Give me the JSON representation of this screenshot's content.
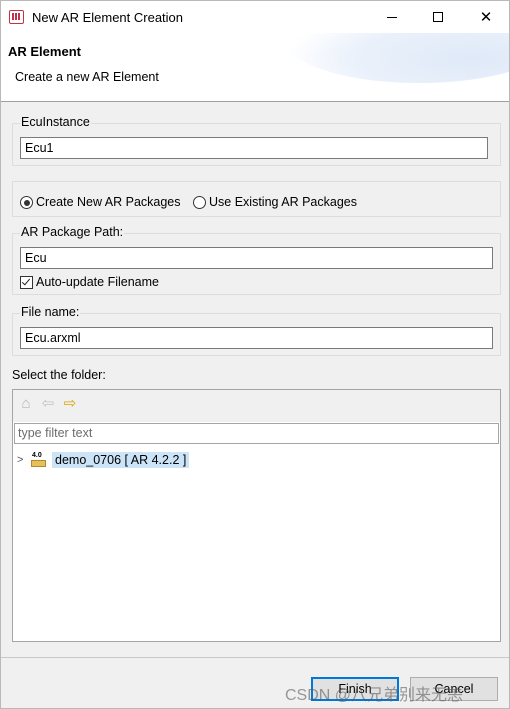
{
  "window": {
    "title": "New AR Element Creation",
    "close_glyph": "✕"
  },
  "header": {
    "title": "AR Element",
    "subtitle": "Create a new AR Element"
  },
  "ecu_instance": {
    "label": "EcuInstance",
    "value": "Ecu1"
  },
  "packages": {
    "create_new_label": "Create New AR Packages",
    "use_existing_label": "Use Existing AR Packages",
    "selected": "create_new"
  },
  "package_path": {
    "label": "AR Package Path:",
    "value": "Ecu",
    "auto_update_label": "Auto-update Filename",
    "auto_update_checked": true
  },
  "file_name": {
    "label": "File name:",
    "value": "Ecu.arxml"
  },
  "folder": {
    "label": "Select the folder:",
    "filter_placeholder": "type filter text",
    "toolbar": {
      "home_icon": "⌂",
      "back_icon": "⇦",
      "forward_icon": "⇨"
    },
    "tree": [
      {
        "label": "demo_0706 [ AR 4.2.2 ]",
        "icon_badge": "4.0"
      }
    ]
  },
  "buttons": {
    "finish": "Finish",
    "cancel": "Cancel"
  },
  "watermark": "CSDN @八兄弟别来无恙"
}
